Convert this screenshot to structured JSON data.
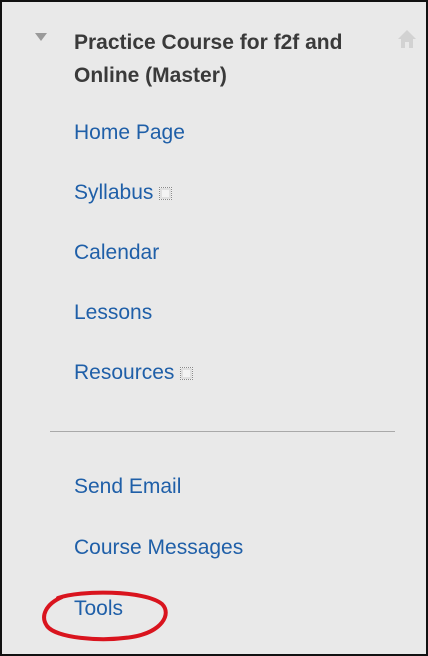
{
  "course": {
    "title": "Practice Course for f2f and Online (Master)"
  },
  "icons": {
    "collapse": "triangle-down-icon",
    "home": "home-icon",
    "item_indicator": "dotted-square-icon"
  },
  "menu": {
    "items": [
      {
        "label": "Home Page"
      },
      {
        "label": "Syllabus"
      },
      {
        "label": "Calendar"
      },
      {
        "label": "Lessons"
      },
      {
        "label": "Resources"
      },
      {
        "label": "Send Email"
      },
      {
        "label": "Course Messages"
      },
      {
        "label": "Tools"
      }
    ]
  },
  "colors": {
    "background": "#e9e9e9",
    "link": "#1f5fa8",
    "title": "#3a3a3a",
    "highlight_annotation": "#d9141e"
  }
}
